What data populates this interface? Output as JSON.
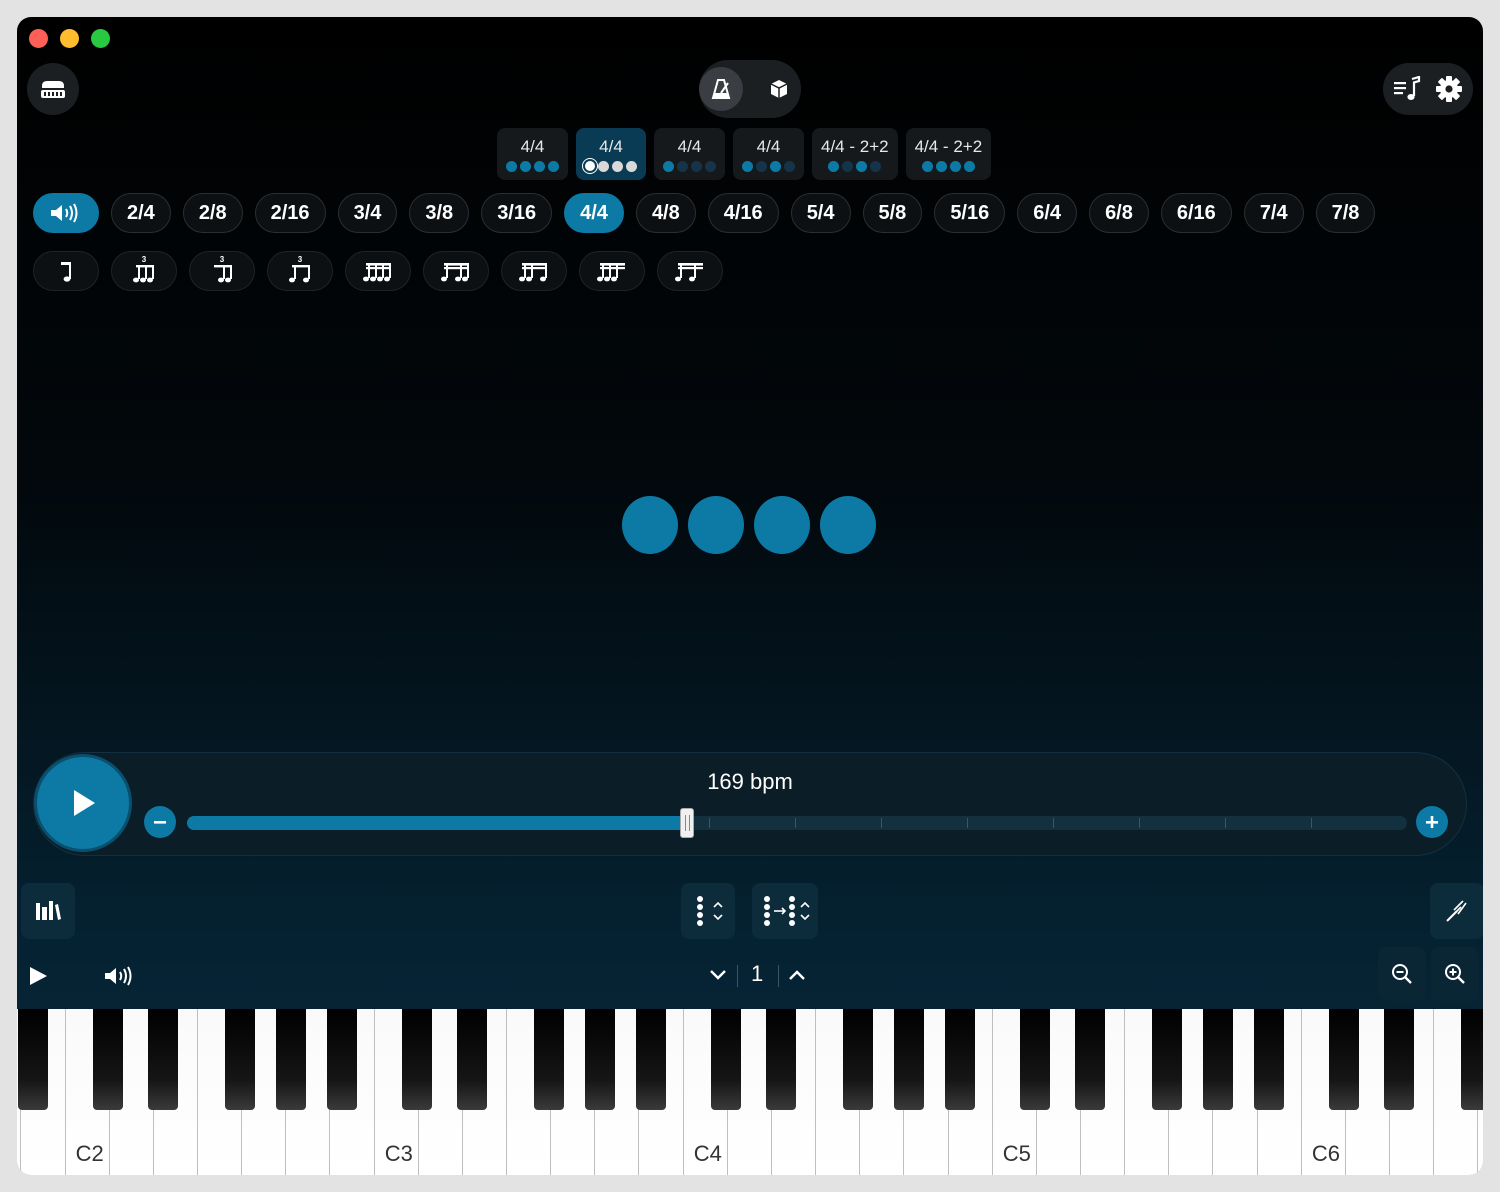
{
  "toolbar": {
    "left_icon": "harmonica-icon",
    "mode_icons": [
      "metronome-icon",
      "cube-icon"
    ],
    "right_icons": [
      "playlist-icon",
      "gear-icon"
    ]
  },
  "presets": [
    {
      "label": "4/4",
      "dots": [
        "on",
        "on",
        "on",
        "on"
      ],
      "active": false
    },
    {
      "label": "4/4",
      "dots": [
        "ring",
        "white",
        "white",
        "white"
      ],
      "active": true
    },
    {
      "label": "4/4",
      "dots": [
        "on",
        "dim",
        "dim",
        "dim"
      ],
      "active": false
    },
    {
      "label": "4/4",
      "dots": [
        "on",
        "dim",
        "on",
        "dim"
      ],
      "active": false
    },
    {
      "label": "4/4 - 2+2",
      "dots": [
        "on",
        "dim",
        "on",
        "dim"
      ],
      "active": false
    },
    {
      "label": "4/4 - 2+2",
      "dots": [
        "on",
        "on",
        "on",
        "on"
      ],
      "active": false
    }
  ],
  "meters": [
    "2/4",
    "2/8",
    "2/16",
    "3/4",
    "3/8",
    "3/16",
    "4/4",
    "4/8",
    "4/16",
    "5/4",
    "5/8",
    "5/16",
    "6/4",
    "6/8",
    "6/16",
    "7/4",
    "7/8"
  ],
  "active_meter": "4/4",
  "subdivisions": [
    "quarter-note-icon",
    "triplet-icon",
    "triplet-rest-first-icon",
    "triplet-rest-middle-icon",
    "sixteenths-icon",
    "sixteenth-pattern-1-icon",
    "sixteenth-pattern-2-icon",
    "sixteenth-pattern-3-icon",
    "sixteenth-pattern-4-icon"
  ],
  "beats": 4,
  "tempo": {
    "label": "169 bpm",
    "value": 169,
    "fraction": 0.41
  },
  "bottom_bar": {
    "bar_number": "1"
  },
  "keyboard": {
    "labels": [
      "C2",
      "C3",
      "C4",
      "C5",
      "C6"
    ]
  },
  "colors": {
    "accent": "#0d7aa6",
    "background": "#000000"
  }
}
